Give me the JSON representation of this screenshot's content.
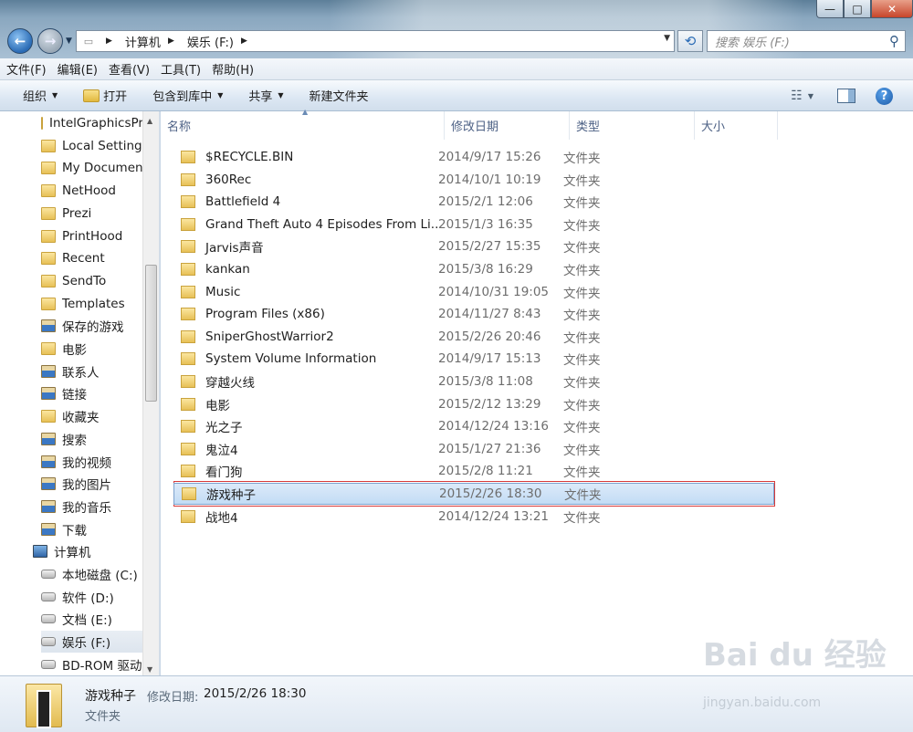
{
  "window": {
    "min": "—",
    "max": "□",
    "close": "✕"
  },
  "address": {
    "crumbs": [
      "计算机",
      "娱乐 (F:)"
    ],
    "search_placeholder": "搜索 娱乐 (F:)"
  },
  "menu": [
    "文件(F)",
    "编辑(E)",
    "查看(V)",
    "工具(T)",
    "帮助(H)"
  ],
  "commands": {
    "organize": "组织",
    "open": "打开",
    "include": "包含到库中",
    "share": "共享",
    "new_folder": "新建文件夹"
  },
  "nav_items": [
    {
      "label": "IntelGraphicsProfiles",
      "icon": "yellow"
    },
    {
      "label": "Local Settings",
      "icon": "yellow"
    },
    {
      "label": "My Documents",
      "icon": "yellow"
    },
    {
      "label": "NetHood",
      "icon": "yellow"
    },
    {
      "label": "Prezi",
      "icon": "yellow"
    },
    {
      "label": "PrintHood",
      "icon": "yellow"
    },
    {
      "label": "Recent",
      "icon": "yellow"
    },
    {
      "label": "SendTo",
      "icon": "yellow"
    },
    {
      "label": "Templates",
      "icon": "yellow"
    },
    {
      "label": "保存的游戏",
      "icon": "blue"
    },
    {
      "label": "电影",
      "icon": "yellow"
    },
    {
      "label": "联系人",
      "icon": "blue"
    },
    {
      "label": "链接",
      "icon": "blue"
    },
    {
      "label": "收藏夹",
      "icon": "yellow"
    },
    {
      "label": "搜索",
      "icon": "blue"
    },
    {
      "label": "我的视频",
      "icon": "blue"
    },
    {
      "label": "我的图片",
      "icon": "blue"
    },
    {
      "label": "我的音乐",
      "icon": "blue"
    },
    {
      "label": "下载",
      "icon": "blue"
    },
    {
      "label": "计算机",
      "icon": "computer"
    },
    {
      "label": "本地磁盘 (C:)",
      "icon": "drive"
    },
    {
      "label": "软件 (D:)",
      "icon": "drive"
    },
    {
      "label": "文档 (E:)",
      "icon": "drive"
    },
    {
      "label": "娱乐 (F:)",
      "icon": "drive"
    },
    {
      "label": "BD-ROM 驱动器",
      "icon": "drive"
    }
  ],
  "columns": {
    "name": "名称",
    "date": "修改日期",
    "type": "类型",
    "size": "大小"
  },
  "files": [
    {
      "name": "$RECYCLE.BIN",
      "date": "2014/9/17 15:26",
      "type": "文件夹"
    },
    {
      "name": "360Rec",
      "date": "2014/10/1 10:19",
      "type": "文件夹"
    },
    {
      "name": "Battlefield 4",
      "date": "2015/2/1 12:06",
      "type": "文件夹"
    },
    {
      "name": "Grand Theft Auto 4 Episodes From Li...",
      "date": "2015/1/3 16:35",
      "type": "文件夹"
    },
    {
      "name": "Jarvis声音",
      "date": "2015/2/27 15:35",
      "type": "文件夹"
    },
    {
      "name": "kankan",
      "date": "2015/3/8 16:29",
      "type": "文件夹"
    },
    {
      "name": "Music",
      "date": "2014/10/31 19:05",
      "type": "文件夹"
    },
    {
      "name": "Program Files (x86)",
      "date": "2014/11/27 8:43",
      "type": "文件夹"
    },
    {
      "name": "SniperGhostWarrior2",
      "date": "2015/2/26 20:46",
      "type": "文件夹"
    },
    {
      "name": "System Volume Information",
      "date": "2014/9/17 15:13",
      "type": "文件夹"
    },
    {
      "name": "穿越火线",
      "date": "2015/3/8 11:08",
      "type": "文件夹"
    },
    {
      "name": "电影",
      "date": "2015/2/12 13:29",
      "type": "文件夹"
    },
    {
      "name": "光之子",
      "date": "2014/12/24 13:16",
      "type": "文件夹"
    },
    {
      "name": "鬼泣4",
      "date": "2015/1/27 21:36",
      "type": "文件夹"
    },
    {
      "name": "看门狗",
      "date": "2015/2/8 11:21",
      "type": "文件夹"
    },
    {
      "name": "游戏种子",
      "date": "2015/2/26 18:30",
      "type": "文件夹"
    },
    {
      "name": "战地4",
      "date": "2014/12/24 13:21",
      "type": "文件夹"
    }
  ],
  "selected_index": 15,
  "details": {
    "name": "游戏种子",
    "date_label": "修改日期:",
    "date": "2015/2/26 18:30",
    "type": "文件夹"
  },
  "watermark": {
    "brand": "Bai du 经验",
    "url": "jingyan.baidu.com"
  },
  "colors": {
    "selection": "#c2dcf5",
    "highlight_box": "#d63a3a",
    "folder": "#e7c056"
  }
}
